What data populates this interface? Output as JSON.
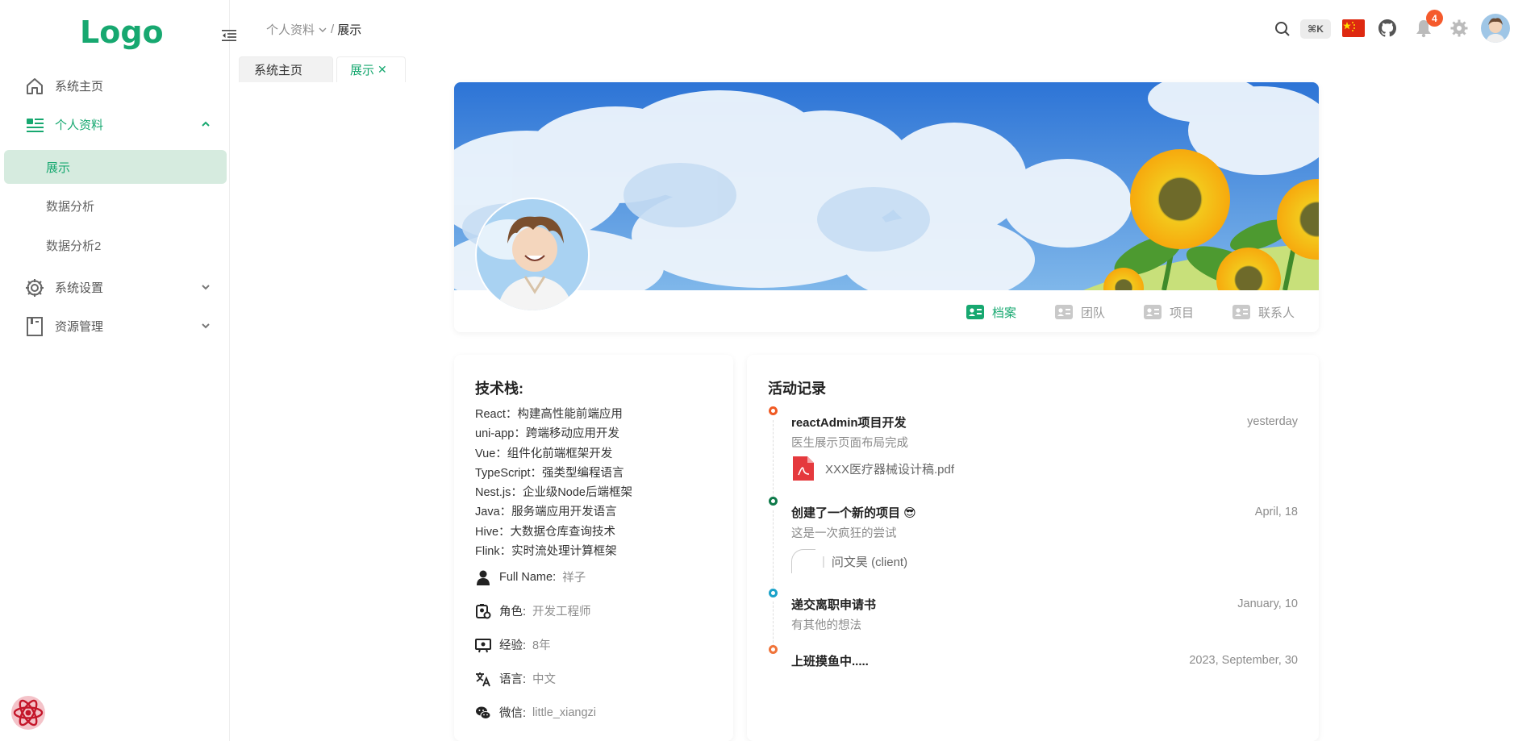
{
  "sidebar": {
    "logo": "Logo",
    "items": [
      {
        "label": "系统主页",
        "icon": "home-icon"
      },
      {
        "label": "个人资料",
        "icon": "profile-icon",
        "expanded": true
      },
      {
        "label": "系统设置",
        "icon": "gear-icon"
      },
      {
        "label": "资源管理",
        "icon": "book-icon"
      }
    ],
    "sub_items": [
      {
        "label": "展示",
        "active": true
      },
      {
        "label": "数据分析"
      },
      {
        "label": "数据分析2"
      }
    ]
  },
  "header": {
    "breadcrumb": [
      "个人资料",
      "展示"
    ],
    "breadcrumb_sep": "/",
    "shortcut": "⌘K",
    "notification_count": "4"
  },
  "tabs": [
    {
      "label": "系统主页"
    },
    {
      "label": "展示",
      "active": true,
      "close": "✕"
    }
  ],
  "profile_tabs": [
    {
      "label": "档案",
      "active": true
    },
    {
      "label": "团队"
    },
    {
      "label": "项目"
    },
    {
      "label": "联系人"
    }
  ],
  "info": {
    "title": "技术栈:",
    "stack": [
      "React：构建高性能前端应用",
      "uni-app：跨端移动应用开发",
      "Vue：组件化前端框架开发",
      "TypeScript：强类型编程语言",
      "Nest.js：企业级Node后端框架",
      "Java：服务端应用开发语言",
      "Hive：大数据仓库查询技术",
      "Flink：实时流处理计算框架"
    ],
    "attributes": [
      {
        "key": "Full Name:",
        "value": "祥子",
        "icon": "user-icon"
      },
      {
        "key": "角色:",
        "value": "开发工程师",
        "icon": "role-icon"
      },
      {
        "key": "经验:",
        "value": "8年",
        "icon": "experience-icon"
      },
      {
        "key": "语言:",
        "value": "中文",
        "icon": "language-icon"
      },
      {
        "key": "微信:",
        "value": "little_xiangzi",
        "icon": "wechat-icon"
      }
    ]
  },
  "activity": {
    "title": "活动记录",
    "items": [
      {
        "title": "reactAdmin项目开发",
        "date": "yesterday",
        "desc": "医生展示页面布局完成",
        "file": "XXX医疗器械设计稿.pdf",
        "color": "#f05a23"
      },
      {
        "title": "创建了一个新的项目 😎",
        "date": "April, 18",
        "desc": "这是一次疯狂的尝试",
        "client": "问文昊 (client)",
        "color": "#0f7a4a"
      },
      {
        "title": "递交离职申请书",
        "date": "January, 10",
        "desc": "有其他的想法",
        "color": "#1ba2c9"
      },
      {
        "title": "上班摸鱼中.....",
        "date": "2023, September, 30",
        "color": "#f0743a"
      }
    ]
  },
  "colors": {
    "accent": "#17a870",
    "active_bg": "#d6ebdf",
    "badge": "#f55a2c"
  }
}
